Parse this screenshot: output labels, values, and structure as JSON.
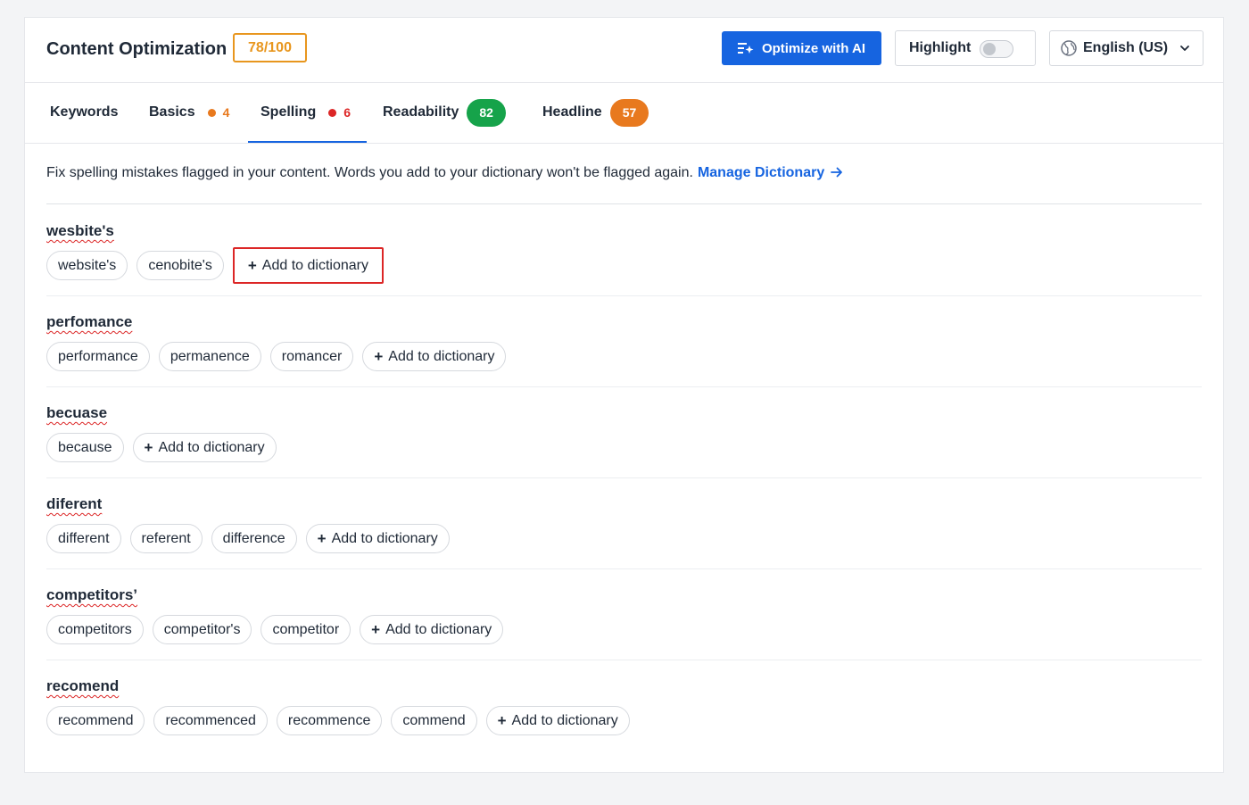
{
  "header": {
    "title": "Content Optimization",
    "score": "78/100",
    "optimize_label": "Optimize with AI",
    "highlight_label": "Highlight",
    "highlight_on": false,
    "language": "English (US)"
  },
  "tabs": [
    {
      "label": "Keywords"
    },
    {
      "label": "Basics",
      "count": "4",
      "dot_color": "#e8791e"
    },
    {
      "label": "Spelling",
      "count": "6",
      "dot_color": "#dc2626",
      "active": true
    },
    {
      "label": "Readability",
      "score": "82",
      "badge_color": "#16a34a"
    },
    {
      "label": "Headline",
      "score": "57",
      "badge_color": "#e8791e"
    }
  ],
  "intro": {
    "text": "Fix spelling mistakes flagged in your content. Words you add to your dictionary won't be flagged again.",
    "link_label": "Manage Dictionary"
  },
  "add_label": "Add to dictionary",
  "groups": [
    {
      "word": "wesbite's",
      "suggestions": [
        "website's",
        "cenobite's"
      ]
    },
    {
      "word": "perfomance",
      "suggestions": [
        "performance",
        "permanence",
        "romancer"
      ]
    },
    {
      "word": "becuase",
      "suggestions": [
        "because"
      ]
    },
    {
      "word": "diferent",
      "suggestions": [
        "different",
        "referent",
        "difference"
      ]
    },
    {
      "word": "competitors’",
      "suggestions": [
        "competitors",
        "competitor's",
        "competitor"
      ]
    },
    {
      "word": "recomend",
      "suggestions": [
        "recommend",
        "recommenced",
        "recommence",
        "commend"
      ]
    }
  ],
  "colors": {
    "accent": "#1664e0",
    "score": "#e8961e",
    "error": "#dc2626"
  }
}
